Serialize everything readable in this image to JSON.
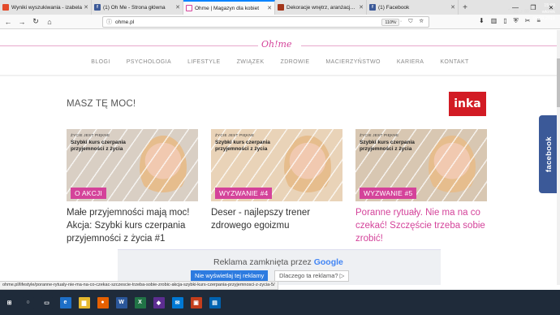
{
  "browser": {
    "tabs": [
      {
        "title": "Wyniki wyszukiwania - izabela",
        "favicon": "search-icon",
        "color": "#e34a2a"
      },
      {
        "title": "(1) Oh Me - Strona główna",
        "favicon": "facebook-icon",
        "color": "#3b5998"
      },
      {
        "title": "Ohme | Magazyn dla kobiet",
        "favicon": "ohme-icon",
        "color": "#ffffff",
        "active": true
      },
      {
        "title": "Dekoracje wnętrz, aranżacje w",
        "favicon": "page-icon",
        "color": "#a3361b"
      },
      {
        "title": "(1) Facebook",
        "favicon": "facebook-icon",
        "color": "#3b5998"
      }
    ],
    "new_tab": "+",
    "window_controls": [
      "—",
      "❐",
      "✕"
    ],
    "url": "ohme.pl",
    "zoom": "110%",
    "url_icons": "··· ⛉ ☆",
    "status_url": "ohme.pl/lifestyle/poranne-rytualy-nie-ma-na-co-czekac-szczescie-trzeba-sobie-zrobic-akcja-szybki-kurs-czerpania-przyjemnosci-z-zycia-5/"
  },
  "site": {
    "logo": "Oh!me",
    "menu": [
      "BLOGI",
      "PSYCHOLOGIA",
      "LIFESTYLE",
      "ZWIĄZEK",
      "ZDROWIE",
      "MACIERZYŃSTWO",
      "KARIERA",
      "KONTAKT"
    ],
    "section_title": "MASZ TĘ MOC!",
    "brand_logo": "inka",
    "facebook_tab": "facebook"
  },
  "cards": [
    {
      "kicker": "ŻYCIE JEST PIĘKNE",
      "headline": "Szybki kurs czerpania przyjemności z życia",
      "badge": "O AKCJI",
      "caption": "Małe przyjemności mają moc! Akcja: Szybki kurs czerpania przyjemności z życia #1",
      "pink": false,
      "bg": "#d9cfc4"
    },
    {
      "kicker": "ŻYCIE JEST PIĘKNE",
      "headline": "Szybki kurs czerpania przyjemności z życia",
      "badge": "WYZWANIE #4",
      "caption": "Deser - najlepszy trener zdrowego egoizmu",
      "pink": false,
      "bg": "#e9d3b8"
    },
    {
      "kicker": "ŻYCIE JEST PIĘKNE",
      "headline": "Szybki kurs czerpania przyjemności z życia",
      "badge": "WYZWANIE #5",
      "caption": "Poranne rytuały. Nie ma na co czekać! Szczęście trzeba sobie zrobić!",
      "pink": true,
      "bg": "#d8c7b2"
    }
  ],
  "ad": {
    "title_prefix": "Reklama zamknięta przez",
    "title_brand": "Google",
    "stop_button": "Nie wyświetlaj tej reklamy",
    "why_button": "Dlaczego ta reklama? ▷"
  },
  "taskbar": {
    "time": "15:08",
    "day": "wtorek",
    "date": "09.04.2019",
    "apps": [
      {
        "icon": "windows-icon",
        "glyph": "⊞",
        "color": "#1f2b3a"
      },
      {
        "icon": "search-icon",
        "glyph": "○",
        "color": "#1f2b3a"
      },
      {
        "icon": "task-view-icon",
        "glyph": "▭",
        "color": "#1f2b3a"
      },
      {
        "icon": "edge-icon",
        "glyph": "e",
        "color": "#1e6fc7"
      },
      {
        "icon": "explorer-icon",
        "glyph": "▆",
        "color": "#e6b92f"
      },
      {
        "icon": "firefox-icon",
        "glyph": "●",
        "color": "#e66000"
      },
      {
        "icon": "word-icon",
        "glyph": "W",
        "color": "#2b579a"
      },
      {
        "icon": "excel-icon",
        "glyph": "X",
        "color": "#217346"
      },
      {
        "icon": "app-icon",
        "glyph": "◆",
        "color": "#5c2d91"
      },
      {
        "icon": "mail-icon",
        "glyph": "✉",
        "color": "#0078d4"
      },
      {
        "icon": "app2-icon",
        "glyph": "▣",
        "color": "#c43e1c"
      },
      {
        "icon": "app3-icon",
        "glyph": "▤",
        "color": "#0063b1"
      }
    ],
    "tray": "⌃ ▭ ♪ ✉"
  }
}
